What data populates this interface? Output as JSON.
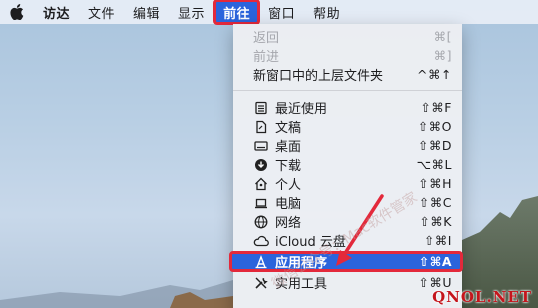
{
  "menubar": {
    "items": [
      {
        "label": "访达"
      },
      {
        "label": "文件"
      },
      {
        "label": "编辑"
      },
      {
        "label": "显示"
      },
      {
        "label": "前往"
      },
      {
        "label": "窗口"
      },
      {
        "label": "帮助"
      }
    ]
  },
  "go_menu": {
    "top_items": [
      {
        "label": "返回",
        "shortcut": "⌘[",
        "disabled": true
      },
      {
        "label": "前进",
        "shortcut": "⌘]",
        "disabled": true
      },
      {
        "label": "新窗口中的上层文件夹",
        "shortcut": "^⌘↑",
        "disabled": false
      }
    ],
    "places": [
      {
        "label": "最近使用",
        "shortcut": "⇧⌘F",
        "icon": "recents-icon"
      },
      {
        "label": "文稿",
        "shortcut": "⇧⌘O",
        "icon": "documents-icon"
      },
      {
        "label": "桌面",
        "shortcut": "⇧⌘D",
        "icon": "desktop-icon"
      },
      {
        "label": "下载",
        "shortcut": "⌥⌘L",
        "icon": "downloads-icon"
      },
      {
        "label": "个人",
        "shortcut": "⇧⌘H",
        "icon": "home-icon"
      },
      {
        "label": "电脑",
        "shortcut": "⇧⌘C",
        "icon": "computer-icon"
      },
      {
        "label": "网络",
        "shortcut": "⇧⌘K",
        "icon": "network-icon"
      },
      {
        "label": "iCloud 云盘",
        "shortcut": "⇧⌘I",
        "icon": "icloud-icon"
      },
      {
        "label": "应用程序",
        "shortcut": "⇧⌘A",
        "icon": "applications-icon"
      },
      {
        "label": "实用工具",
        "shortcut": "⇧⌘U",
        "icon": "utilities-icon"
      }
    ]
  },
  "watermark": "微信公众号：Mac软件管家",
  "site_logo": "QNOL.NET",
  "colors": {
    "highlight": "#2b64dc",
    "annotation": "#e3293b"
  }
}
